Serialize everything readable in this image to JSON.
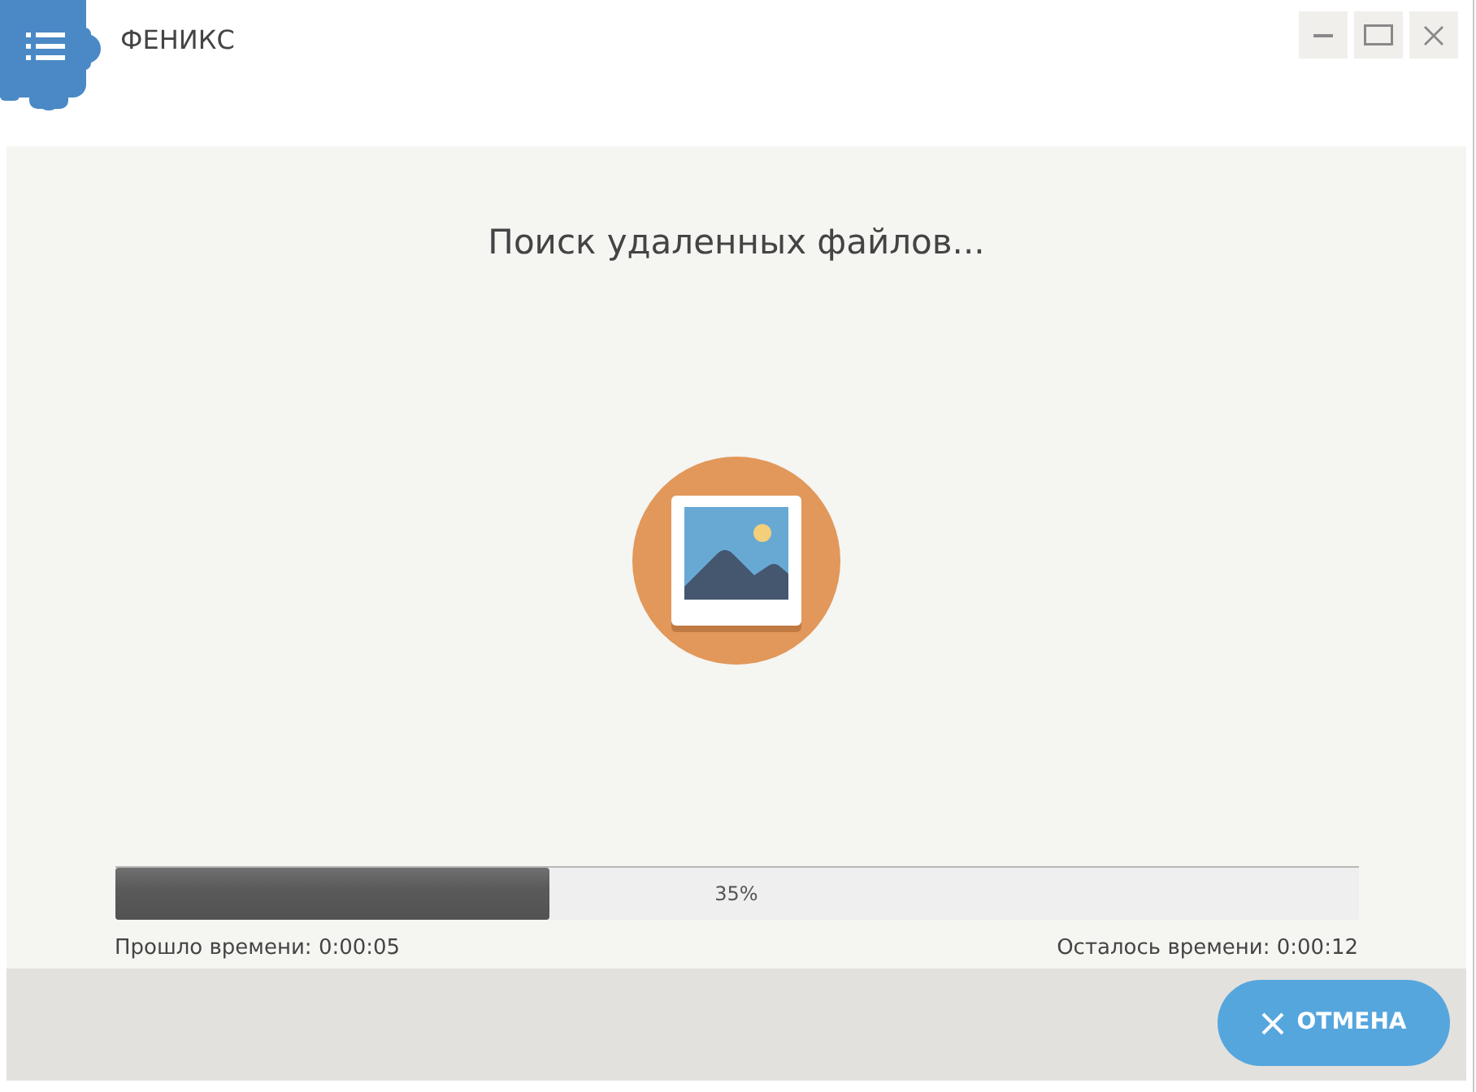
{
  "window": {
    "title": "ФЕНИКС",
    "controls": [
      {
        "kind": "minimize"
      },
      {
        "kind": "maximize"
      },
      {
        "kind": "close"
      }
    ]
  },
  "heading": "Поиск удаленных файлов...",
  "progress": {
    "level": 0.35,
    "percent": "35%"
  },
  "elapsed": "Прошло времени: 0:00:05",
  "remaining": "Осталось времени: 0:00:12",
  "buttons": [
    {
      "kind": "cancel",
      "label": "ОТМЕНА"
    }
  ]
}
